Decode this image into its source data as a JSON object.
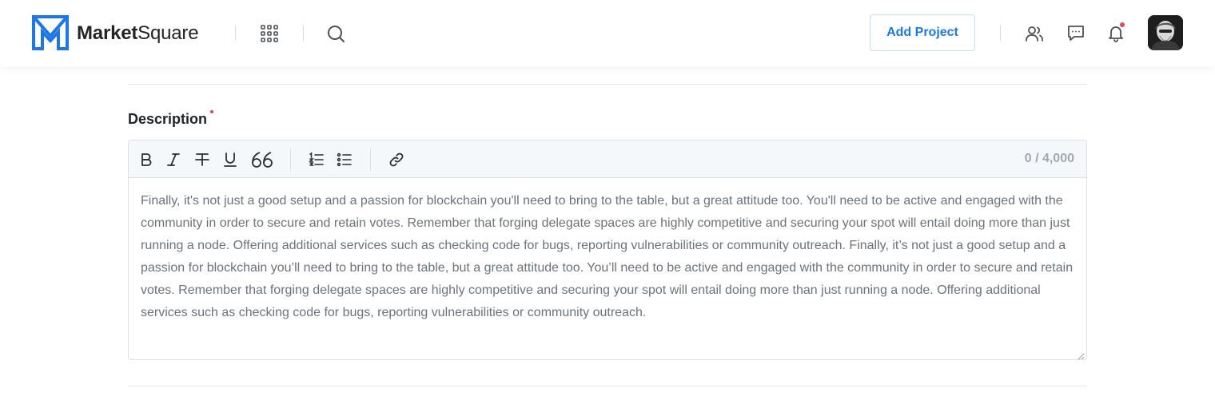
{
  "header": {
    "logo_strong": "Market",
    "logo_light": "Square",
    "add_project_label": "Add Project",
    "brand_color": "#1c78e4",
    "icons": [
      "apps-grid-icon",
      "search-icon",
      "users-icon",
      "chat-icon",
      "bell-icon"
    ],
    "notification_dot_color": "#e5484d"
  },
  "form": {
    "description_label": "Description",
    "required": true,
    "toolbar": {
      "buttons": [
        "bold",
        "italic",
        "strikethrough",
        "underline",
        "quote",
        "ordered-list",
        "unordered-list",
        "link"
      ],
      "char_counter": "0 / 4,000"
    },
    "description_text": "Finally, it's not just a good setup and a passion for blockchain you'll need to bring to the table, but a great attitude too. You'll need to be active and engaged with the community in order to secure and retain votes. Remember that forging delegate spaces are highly competitive and securing your spot will entail doing more than just running a node. Offering additional services such as checking code for bugs, reporting vulnerabilities or community outreach. Finally, it’s not just a good setup and a passion for blockchain you’ll need to bring to the table, but a great attitude too. You’ll need to be active and engaged with the community in order to secure and retain votes. Remember that forging delegate spaces are highly competitive and securing your spot will entail doing more than just running a node. Offering additional services such as checking code for bugs, reporting vulnerabilities or community outreach."
  }
}
